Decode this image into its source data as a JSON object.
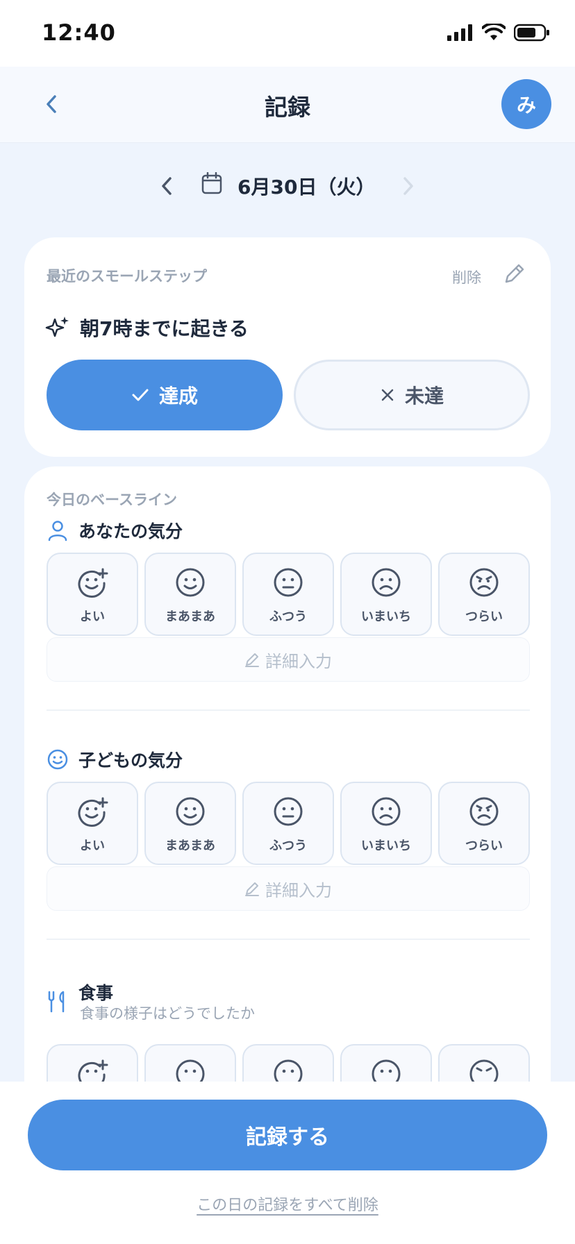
{
  "status_bar": {
    "time": "12:40"
  },
  "header": {
    "title": "記録",
    "avatar_initial": "み"
  },
  "date_nav": {
    "date": "6月30日（火）"
  },
  "small_step": {
    "section_label": "最近のスモールステップ",
    "delete_label": "削除",
    "title": "朝7時までに起きる",
    "achieved_label": "達成",
    "missed_label": "未達",
    "selected": "achieved"
  },
  "baseline": {
    "section_label": "今日のベースライン",
    "your_mood": {
      "title": "あなたの気分",
      "options": [
        "よい",
        "まあまあ",
        "ふつう",
        "いまいち",
        "つらい"
      ],
      "detail_label": "詳細入力"
    },
    "child_mood": {
      "title": "子どもの気分",
      "options": [
        "よい",
        "まあまあ",
        "ふつう",
        "いまいち",
        "つらい"
      ],
      "detail_label": "詳細入力"
    },
    "meal": {
      "title": "食事",
      "subtitle": "食事の様子はどうでしたか"
    }
  },
  "footer": {
    "record_label": "記録する",
    "delete_all_label": "この日の記録をすべて削除"
  },
  "colors": {
    "accent": "#4a8fe2",
    "text": "#1f2a3c",
    "muted": "#9aa5b4",
    "background": "#eef4fd"
  }
}
